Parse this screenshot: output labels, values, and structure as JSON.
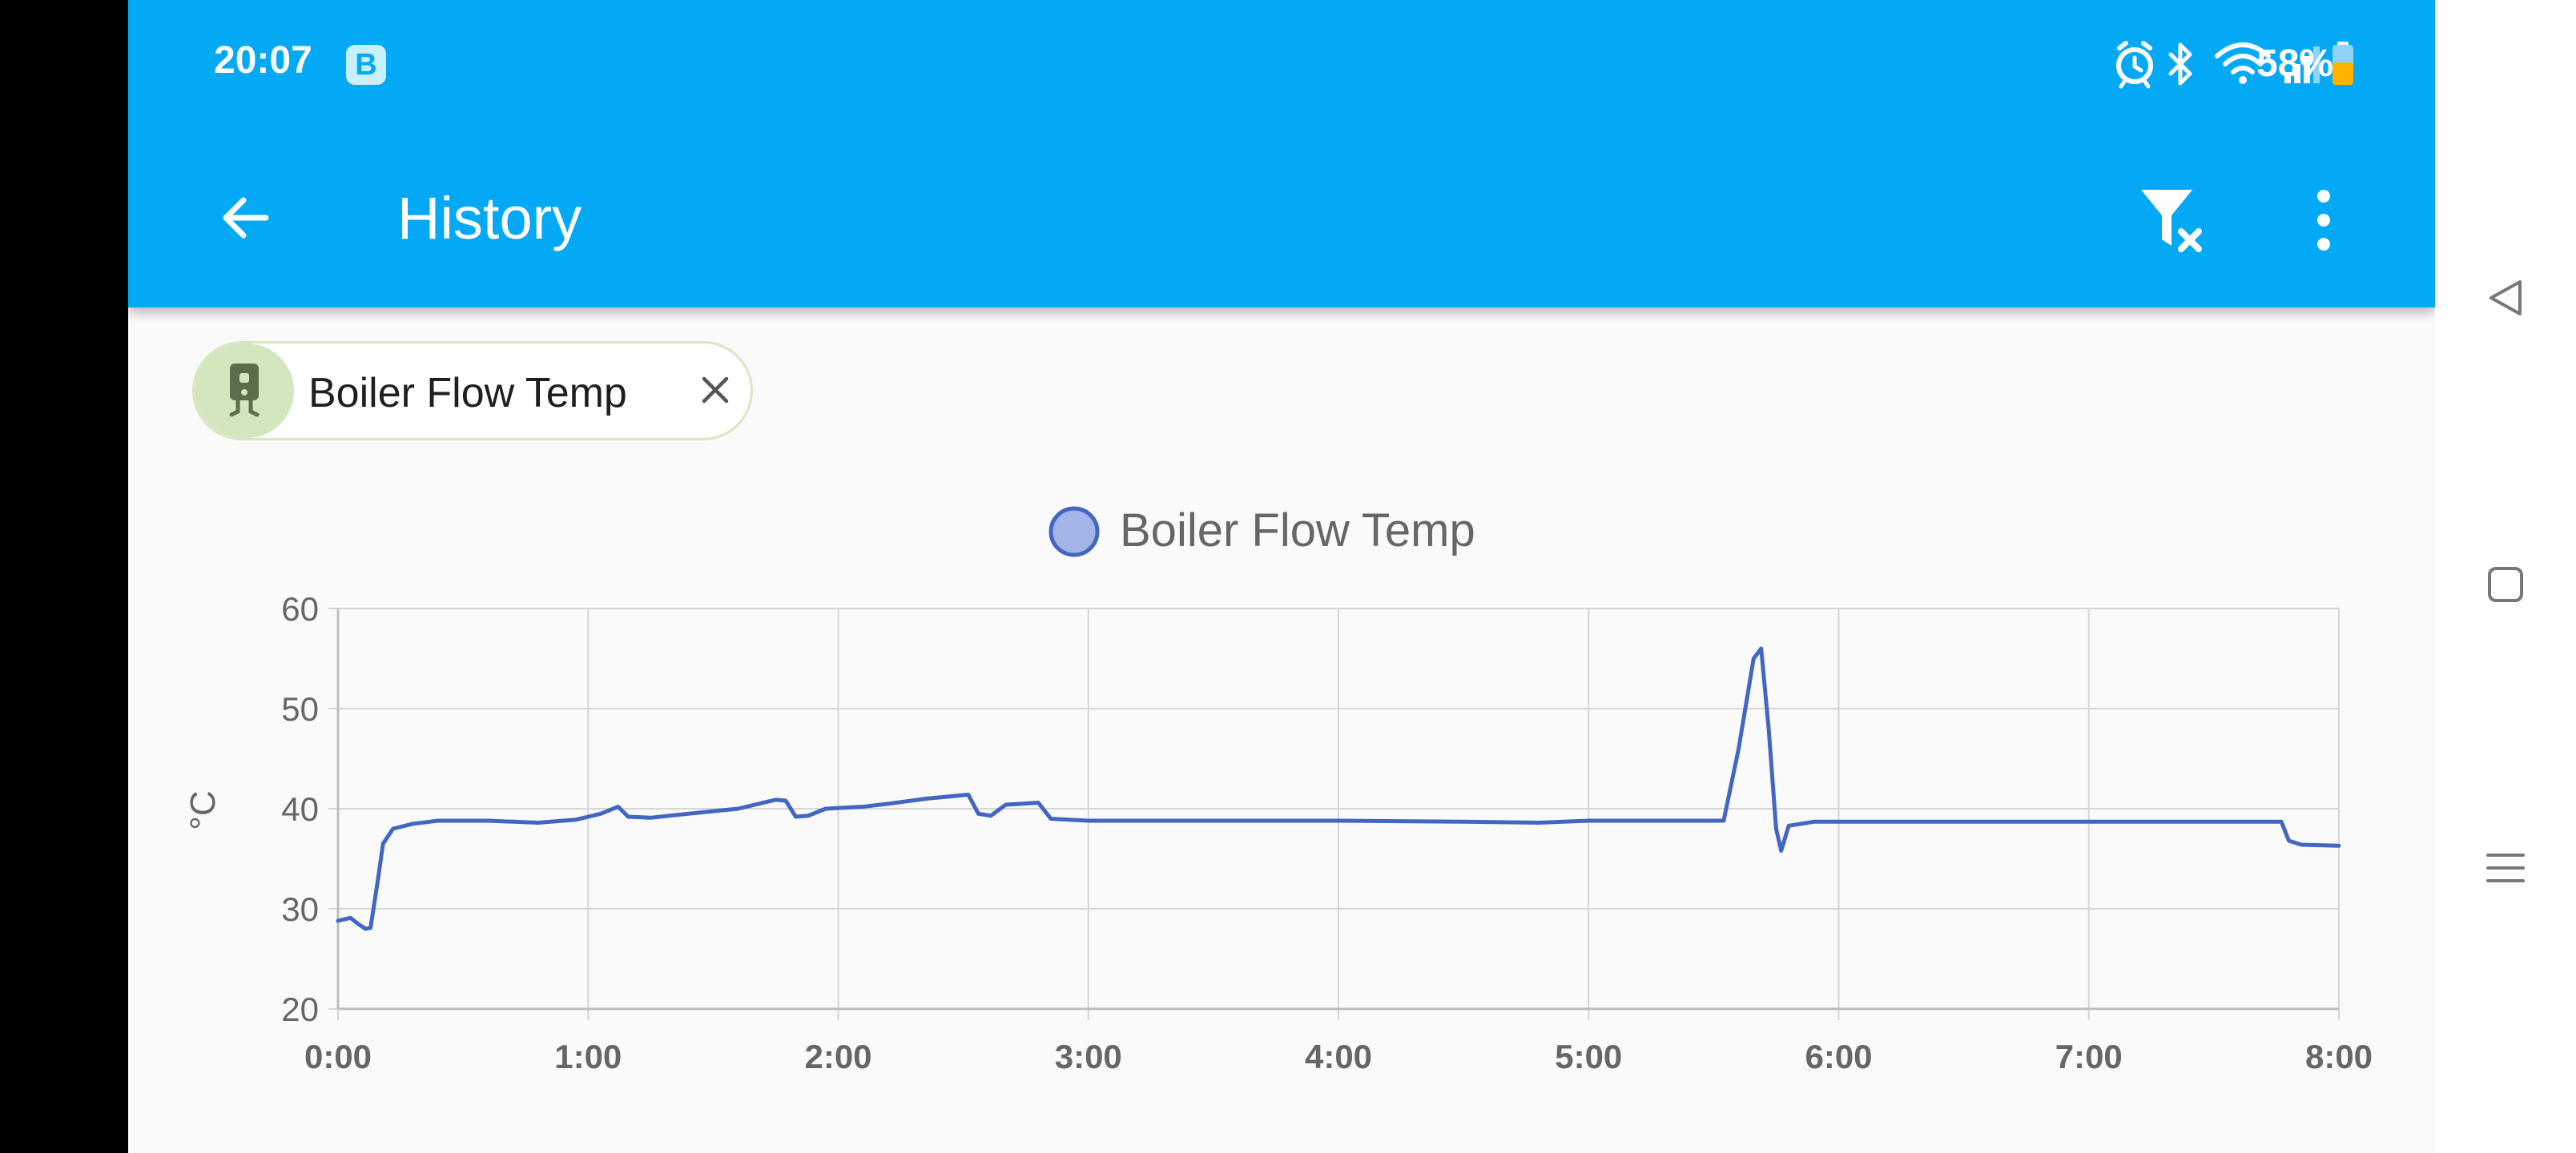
{
  "status_bar": {
    "time": "20:07",
    "badge": "B",
    "battery": "58%",
    "icons": [
      "alarm-icon",
      "bluetooth-icon",
      "wifi-icon",
      "signal-icon",
      "battery-icon"
    ]
  },
  "toolbar": {
    "title": "History",
    "back_icon": "arrow-left-icon",
    "filter_icon": "filter-remove-icon",
    "more_icon": "more-vertical-icon"
  },
  "filter_chip": {
    "label": "Boiler Flow Temp",
    "icon": "boiler-icon",
    "close_icon": "close-icon"
  },
  "colors": {
    "app_bar": "#03a9f4",
    "series": "#4266c2",
    "series_fill": "#a3b4e6",
    "chip_avatar": "#d3e6bd"
  },
  "chart_data": {
    "type": "line",
    "title": "",
    "ylabel": "°C",
    "xlabel": "",
    "ylim": [
      20,
      60
    ],
    "yticks": [
      20,
      30,
      40,
      50,
      60
    ],
    "xlim": [
      0,
      8
    ],
    "xticks": [
      "0:00",
      "1:00",
      "2:00",
      "3:00",
      "4:00",
      "5:00",
      "6:00",
      "7:00",
      "8:00"
    ],
    "grid": true,
    "legend_position": "top-center",
    "series": [
      {
        "name": "Boiler Flow Temp",
        "x_unit": "hours",
        "points": [
          [
            0.0,
            28.8
          ],
          [
            0.05,
            29.1
          ],
          [
            0.08,
            28.5
          ],
          [
            0.11,
            28.0
          ],
          [
            0.13,
            28.1
          ],
          [
            0.16,
            33.0
          ],
          [
            0.18,
            36.5
          ],
          [
            0.22,
            38.0
          ],
          [
            0.3,
            38.5
          ],
          [
            0.4,
            38.8
          ],
          [
            0.6,
            38.8
          ],
          [
            0.8,
            38.6
          ],
          [
            0.95,
            38.9
          ],
          [
            1.05,
            39.5
          ],
          [
            1.12,
            40.2
          ],
          [
            1.16,
            39.2
          ],
          [
            1.25,
            39.1
          ],
          [
            1.4,
            39.5
          ],
          [
            1.6,
            40.0
          ],
          [
            1.75,
            40.9
          ],
          [
            1.79,
            40.8
          ],
          [
            1.83,
            39.2
          ],
          [
            1.88,
            39.3
          ],
          [
            1.95,
            40.0
          ],
          [
            2.1,
            40.2
          ],
          [
            2.2,
            40.5
          ],
          [
            2.35,
            41.0
          ],
          [
            2.52,
            41.4
          ],
          [
            2.56,
            39.5
          ],
          [
            2.61,
            39.3
          ],
          [
            2.67,
            40.4
          ],
          [
            2.8,
            40.6
          ],
          [
            2.85,
            39.0
          ],
          [
            3.0,
            38.8
          ],
          [
            3.5,
            38.8
          ],
          [
            4.0,
            38.8
          ],
          [
            4.5,
            38.7
          ],
          [
            4.8,
            38.6
          ],
          [
            5.0,
            38.8
          ],
          [
            5.25,
            38.8
          ],
          [
            5.54,
            38.8
          ],
          [
            5.6,
            46.0
          ],
          [
            5.66,
            55.0
          ],
          [
            5.69,
            56.0
          ],
          [
            5.72,
            48.0
          ],
          [
            5.75,
            38.0
          ],
          [
            5.77,
            35.8
          ],
          [
            5.8,
            38.3
          ],
          [
            5.9,
            38.7
          ],
          [
            6.5,
            38.7
          ],
          [
            7.0,
            38.7
          ],
          [
            7.5,
            38.7
          ],
          [
            7.77,
            38.7
          ],
          [
            7.8,
            36.8
          ],
          [
            7.85,
            36.4
          ],
          [
            8.0,
            36.3
          ]
        ]
      }
    ]
  }
}
